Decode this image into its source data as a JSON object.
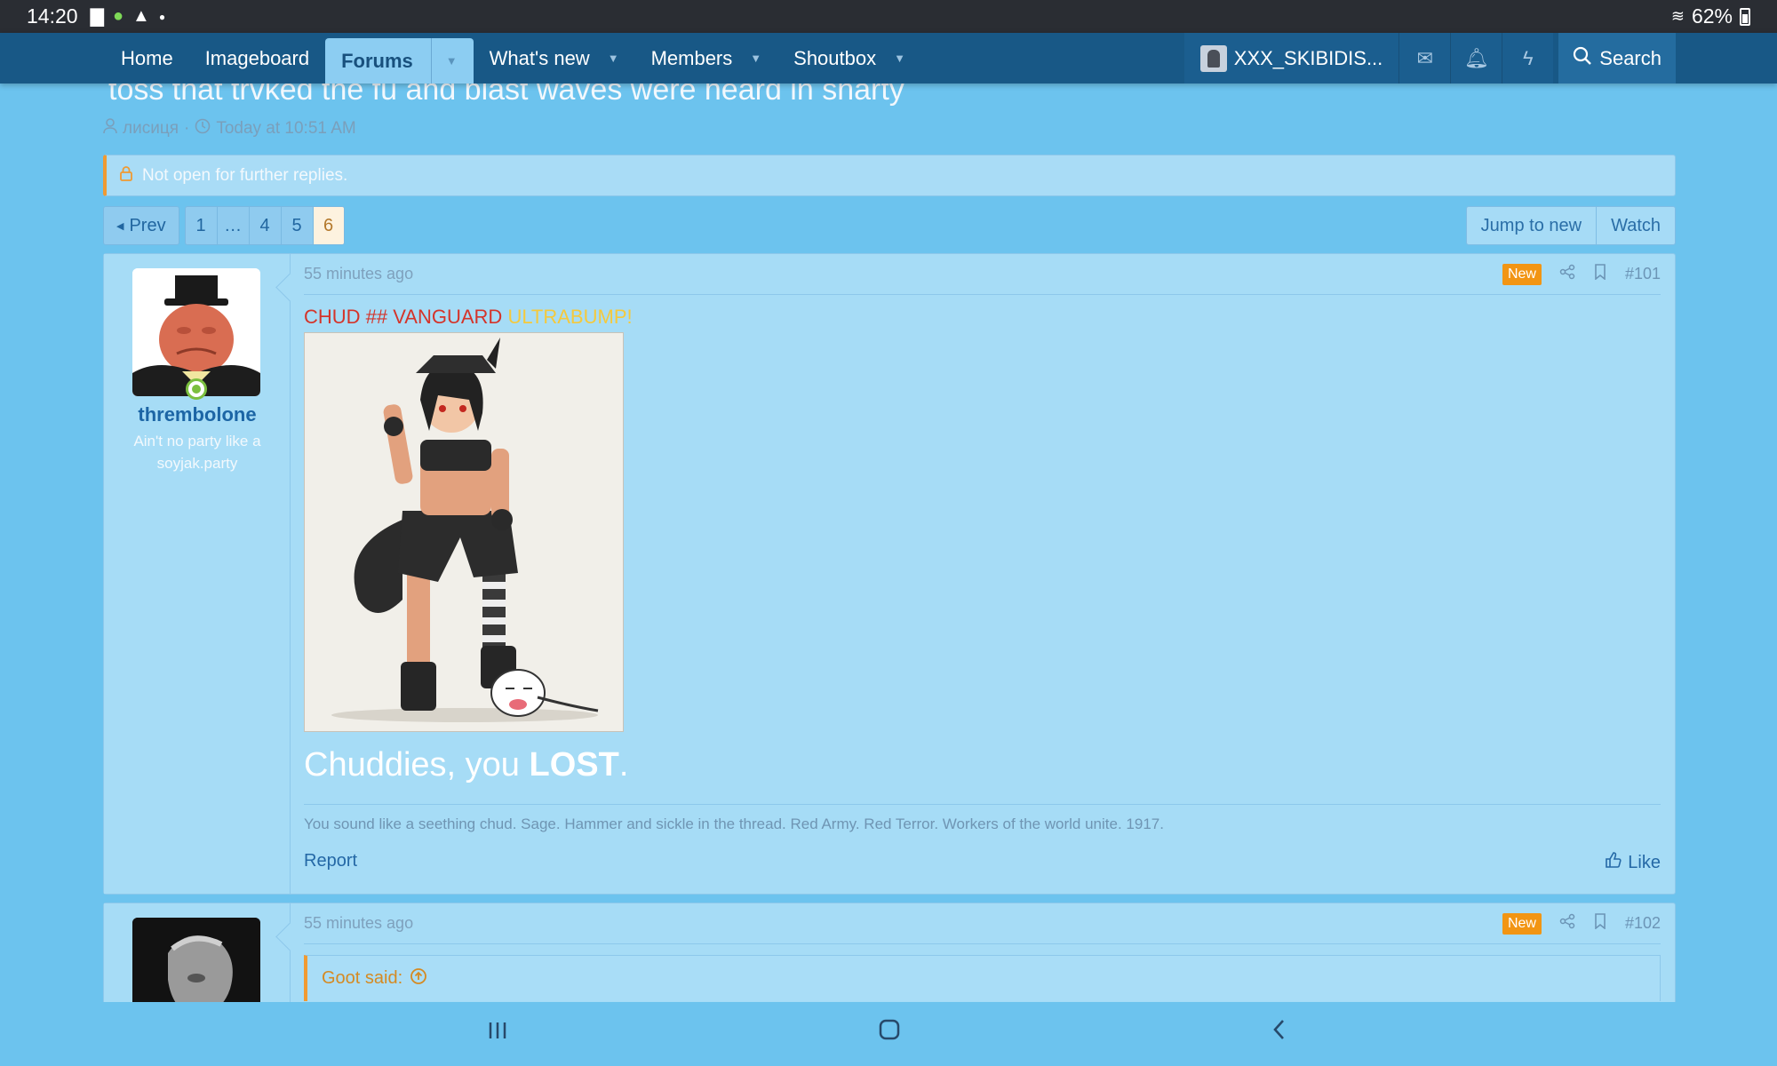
{
  "statusbar": {
    "time": "14:20",
    "battery": "62%",
    "icons": [
      "folder-icon",
      "alien-icon",
      "warning-icon",
      "dot-icon",
      "wifi-icon",
      "battery-icon"
    ]
  },
  "nav": {
    "tabs": [
      {
        "label": "Home",
        "has_caret": false
      },
      {
        "label": "Imageboard",
        "has_caret": false
      },
      {
        "label": "Forums",
        "has_caret": true,
        "active": true
      },
      {
        "label": "What's new",
        "has_caret": true
      },
      {
        "label": "Members",
        "has_caret": true
      },
      {
        "label": "Shoutbox",
        "has_caret": true
      }
    ],
    "username": "XXX_SKIBIDIS...",
    "search_label": "Search",
    "icons": [
      "envelope-icon",
      "bell-icon",
      "bolt-icon",
      "search-icon"
    ]
  },
  "thread": {
    "title": "toss that trvked the fu and blast waves were heard in sharty",
    "author": "лисиця",
    "date": "Today at 10:51 AM",
    "notice": "Not open for further replies."
  },
  "pagination": {
    "prev_label": "Prev",
    "pages": [
      "1",
      "…",
      "4",
      "5",
      "6"
    ],
    "current": "6",
    "jump_label": "Jump to new",
    "watch_label": "Watch"
  },
  "posts": [
    {
      "time": "55 minutes ago",
      "badge": "New",
      "number": "#101",
      "username": "thrembolone",
      "user_title": "Ain't no party like a soyjak.party",
      "line_red": "CHUD ## VANGUARD",
      "line_yellow": "ULTRABUMP!",
      "big_text_pre": "Chuddies, you",
      "big_text_bold": "LOST",
      "big_text_post": ".",
      "signature": "You sound like a seething chud. Sage. Hammer and sickle in the thread. Red Army. Red Terror. Workers of the world unite. 1917.",
      "report_label": "Report",
      "like_label": "Like"
    },
    {
      "time": "55 minutes ago",
      "badge": "New",
      "number": "#102",
      "quote_label": "Goot said:"
    }
  ],
  "colors": {
    "page_bg": "#6cc3ee",
    "navbar": "#185886",
    "new_badge": "#f29513",
    "accent_orange": "#f09a32",
    "link_blue": "#2468a6"
  }
}
